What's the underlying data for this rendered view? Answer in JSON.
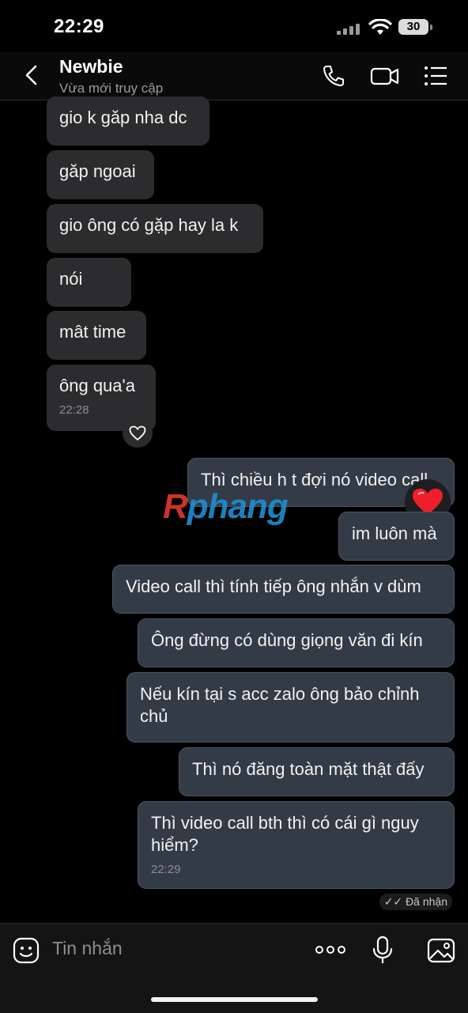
{
  "status": {
    "time": "22:29",
    "battery": "30"
  },
  "header": {
    "name": "Newbie",
    "subtitle": "Vừa mới truy cập"
  },
  "messages": {
    "m1": "gio k găp nha dc",
    "m2": "găp ngoai",
    "m3": "gio ông có gặp hay la k",
    "m4": "nói",
    "m5": "mât time",
    "m6": "ông qua'a",
    "m6_time": "22:28",
    "m7": "Thì chiều h t đợi nó video call",
    "m8": "im luôn mà",
    "m9": "Video call thì tính tiếp ông nhắn v dùm",
    "m10": "Ông đừng có dùng giọng văn đi kín",
    "m11": "Nếu kín tại s acc zalo ông bảo chỉnh chủ",
    "m12": "Thì nó đăng toàn mặt thật đấy",
    "m13": "Thì video call bth thì có cái gì nguy hiểm?",
    "m13_time": "22:29"
  },
  "watermark": {
    "first": "R",
    "rest": "phang"
  },
  "delivered": "Đã nhận",
  "input": {
    "placeholder": "Tin nhắn"
  },
  "colors": {
    "incoming": "#2c2c2e",
    "outgoing": "#333b47",
    "background": "#000000"
  },
  "icons": [
    "back-icon",
    "phone-icon",
    "video-call-icon",
    "menu-list-icon",
    "heart-outline-icon",
    "heart-reaction-icon",
    "sticker-icon",
    "more-icon",
    "microphone-icon",
    "image-icon"
  ]
}
